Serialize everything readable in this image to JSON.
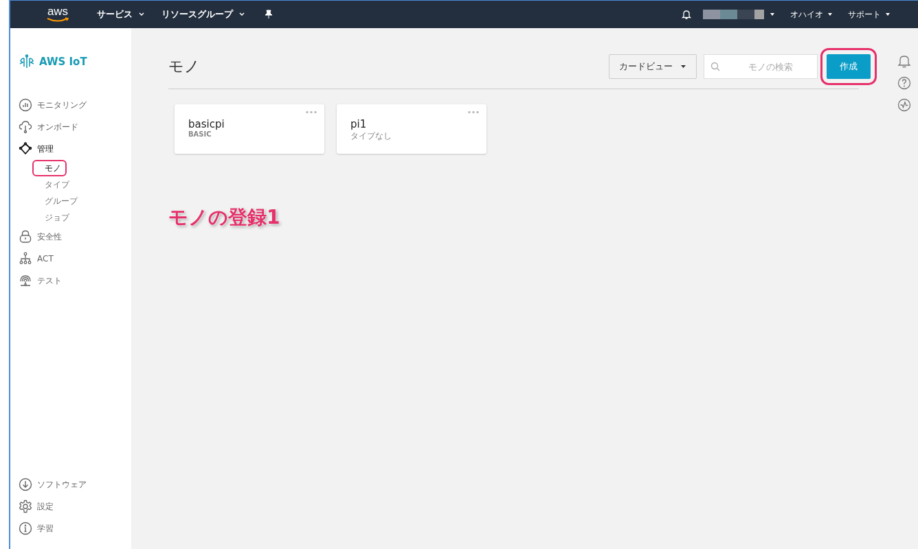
{
  "top_bar": {
    "logo": "aws",
    "menus": [
      {
        "label": "サービス"
      },
      {
        "label": "リソースグループ"
      }
    ],
    "region": "オハイオ",
    "support": "サポート"
  },
  "sidebar": {
    "brand": "AWS IoT",
    "items": [
      {
        "label": "モニタリング",
        "selected": false
      },
      {
        "label": "オンボード",
        "selected": false
      },
      {
        "label": "管理",
        "selected": true,
        "children": [
          {
            "label": "モノ",
            "selected": true,
            "highlighted": true
          },
          {
            "label": "タイプ",
            "selected": false,
            "highlighted": false
          },
          {
            "label": "グループ",
            "selected": false,
            "highlighted": false
          },
          {
            "label": "ジョブ",
            "selected": false,
            "highlighted": false
          }
        ]
      },
      {
        "label": "安全性",
        "selected": false
      },
      {
        "label": "ACT",
        "selected": false
      },
      {
        "label": "テスト",
        "selected": false
      }
    ],
    "bottom_items": [
      {
        "label": "ソフトウェア"
      },
      {
        "label": "設定"
      },
      {
        "label": "学習"
      }
    ]
  },
  "page": {
    "title": "モノ",
    "view_dropdown": "カードビュー",
    "search": {
      "placeholder": "モノの検索"
    },
    "create_button": {
      "label": "作成",
      "highlighted": true
    }
  },
  "cards": [
    {
      "name": "basicpi",
      "type": "BASIC",
      "kind": "typed"
    },
    {
      "name": "pi1",
      "type": "タイプなし",
      "kind": "untyped"
    }
  ],
  "annotation": "モノの登録1"
}
